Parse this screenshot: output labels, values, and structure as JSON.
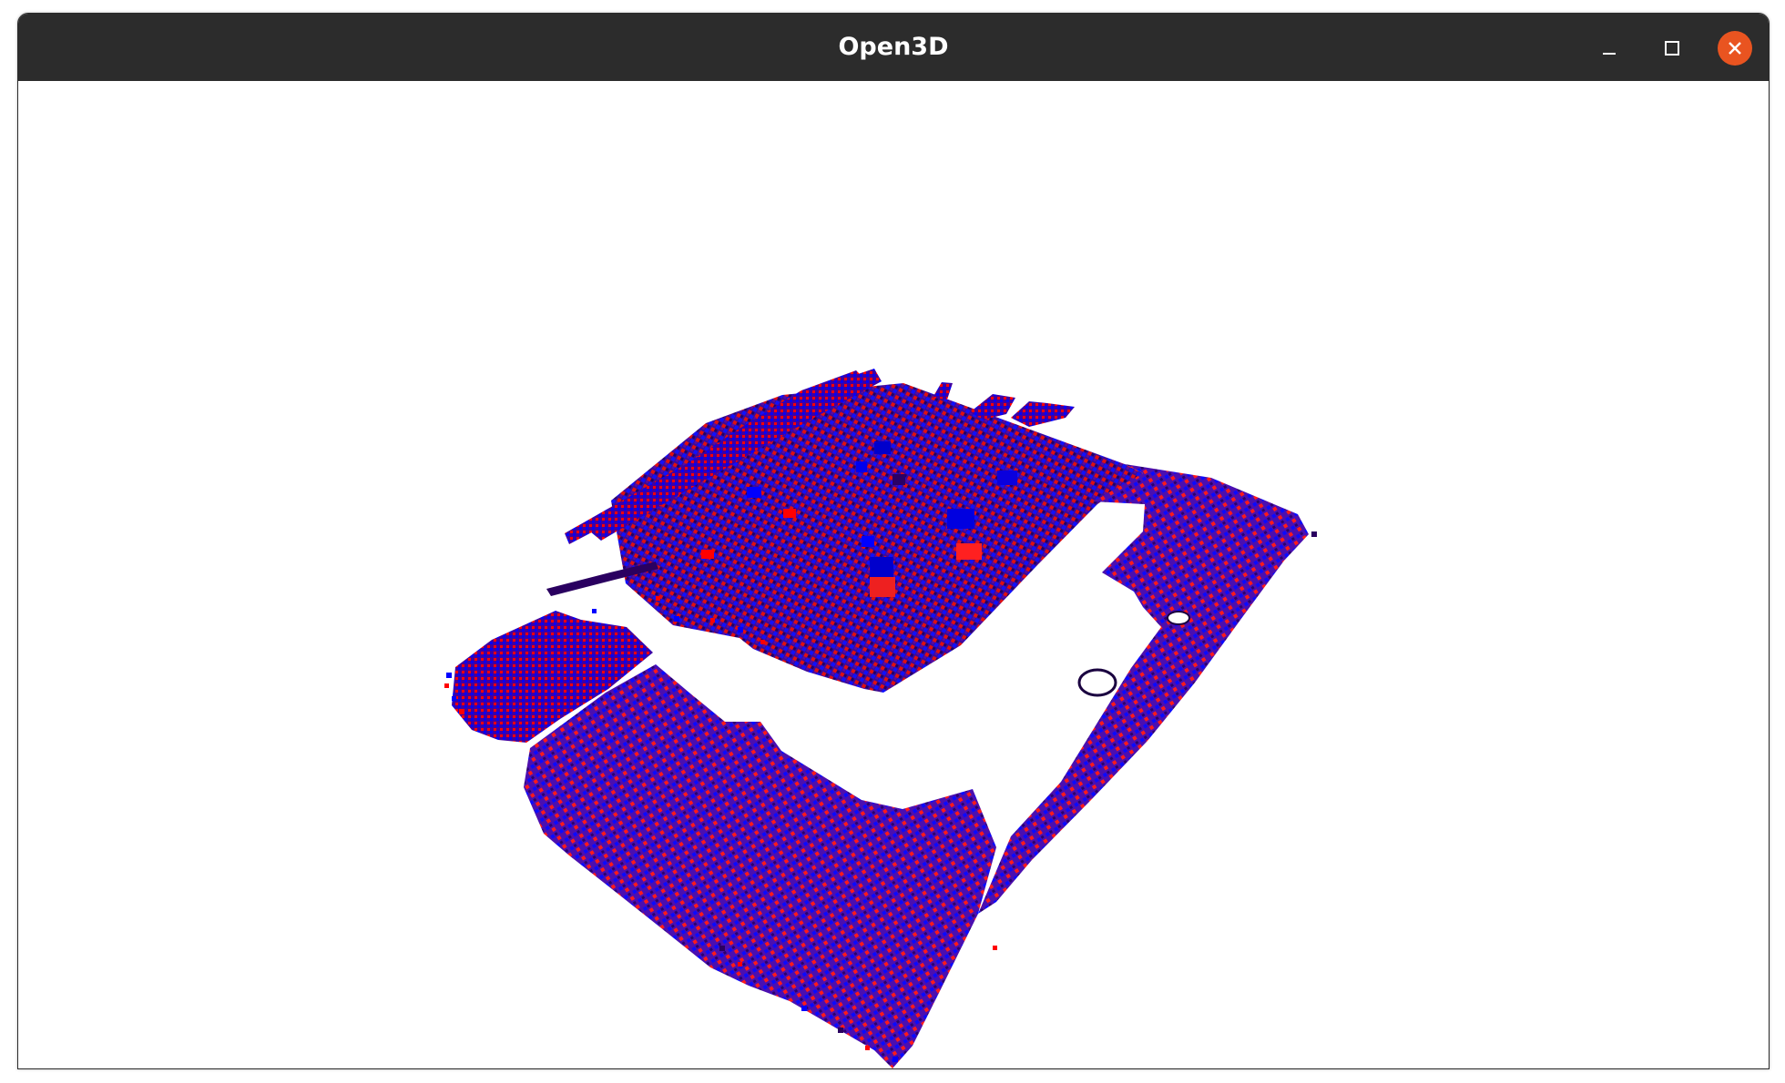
{
  "window": {
    "title": "Open3D"
  },
  "controls": {
    "minimize_icon": "minimize-icon",
    "maximize_icon": "maximize-icon",
    "close_icon": "close-icon"
  },
  "viewport": {
    "background": "#ffffff",
    "point_colors": [
      "#0000ff",
      "#ff0000",
      "#2a0050"
    ]
  },
  "colors": {
    "titlebar": "#2c2c2c",
    "close_button": "#e95420",
    "title_text": "#ffffff"
  }
}
